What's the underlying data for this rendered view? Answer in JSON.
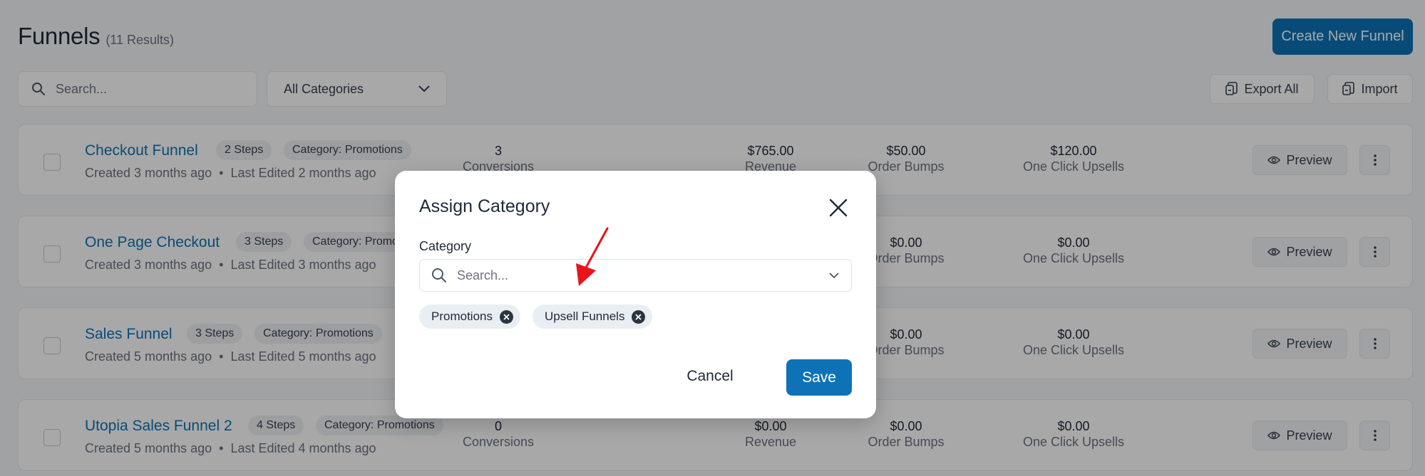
{
  "header": {
    "title": "Funnels",
    "result_count": "(11 Results)",
    "create_button": "Create New Funnel"
  },
  "toolbar": {
    "search_placeholder": "Search...",
    "category_filter": "All Categories",
    "export_label": "Export All",
    "import_label": "Import"
  },
  "rows": [
    {
      "name": "Checkout Funnel",
      "steps": "2 Steps",
      "category": "Category: Promotions",
      "created": "Created 3 months ago",
      "edited": "Last Edited 2 months ago",
      "conversions": "3",
      "conversions_label": "Conversions",
      "revenue": "$765.00",
      "revenue_label": "Revenue",
      "order_bumps": "$50.00",
      "order_bumps_label": "Order Bumps",
      "upsells": "$120.00",
      "upsells_label": "One Click Upsells",
      "preview": "Preview"
    },
    {
      "name": "One Page Checkout",
      "steps": "3 Steps",
      "category": "Category: Promotions",
      "created": "Created 3 months ago",
      "edited": "Last Edited 3 months ago",
      "conversions": "",
      "conversions_label": "",
      "revenue": "",
      "revenue_label": "",
      "order_bumps": "$0.00",
      "order_bumps_label": "Order Bumps",
      "upsells": "$0.00",
      "upsells_label": "One Click Upsells",
      "preview": "Preview"
    },
    {
      "name": "Sales Funnel",
      "steps": "3 Steps",
      "category": "Category: Promotions",
      "created": "Created 5 months ago",
      "edited": "Last Edited 5 months ago",
      "conversions": "",
      "conversions_label": "",
      "revenue": "",
      "revenue_label": "",
      "order_bumps": "$0.00",
      "order_bumps_label": "Order Bumps",
      "upsells": "$0.00",
      "upsells_label": "One Click Upsells",
      "preview": "Preview"
    },
    {
      "name": "Utopia Sales Funnel 2",
      "steps": "4 Steps",
      "category": "Category: Promotions",
      "created": "Created 5 months ago",
      "edited": "Last Edited 4 months ago",
      "conversions": "0",
      "conversions_label": "Conversions",
      "revenue": "$0.00",
      "revenue_label": "Revenue",
      "order_bumps": "$0.00",
      "order_bumps_label": "Order Bumps",
      "upsells": "$0.00",
      "upsells_label": "One Click Upsells",
      "preview": "Preview"
    }
  ],
  "modal": {
    "title": "Assign Category",
    "field_label": "Category",
    "search_placeholder": "Search...",
    "selected": [
      "Promotions",
      "Upsell Funnels"
    ],
    "cancel_label": "Cancel",
    "save_label": "Save"
  },
  "colors": {
    "accent": "#0e73b6",
    "overlay": "rgba(0,0,0,0.34)",
    "annotation_arrow": "#e8141c"
  }
}
